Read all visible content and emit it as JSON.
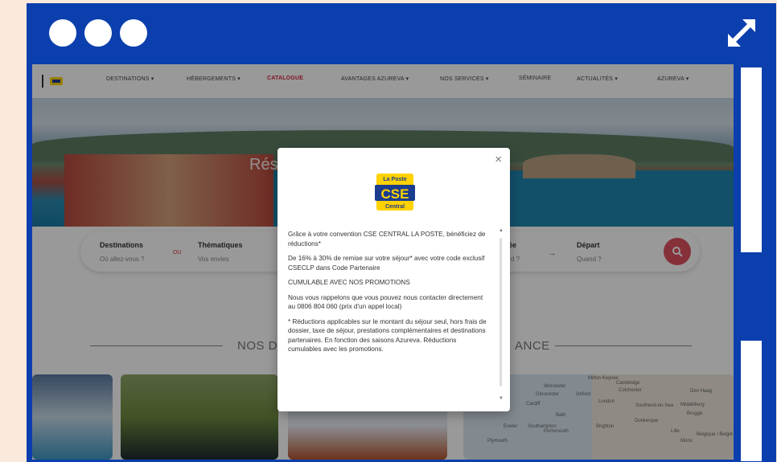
{
  "nav": {
    "items": [
      {
        "label": "DESTINATIONS ▾"
      },
      {
        "label": "HÉBERGEMENTS ▾"
      },
      {
        "label": "CATALOGUE"
      },
      {
        "label": "AVANTAGES AZUREVA ▾"
      },
      {
        "label": "NOS SERVICES ▾"
      },
      {
        "label": "SÉMINAIRE"
      },
      {
        "label": "ACTUALITÉS ▾"
      },
      {
        "label": "AZUREVA ▾"
      }
    ]
  },
  "hero": {
    "text": "Rés                                         es"
  },
  "search": {
    "destinations_label": "Destinations",
    "destinations_placeholder": "Où allez-vous ?",
    "ou": "OU",
    "thematiques_label": "Thématiques",
    "thematiques_placeholder": "Vos envies",
    "arrivee_label": "ée",
    "arrivee_placeholder": "d ?",
    "arrow": "→",
    "depart_label": "Départ",
    "depart_placeholder": "Quand ?"
  },
  "section": {
    "left": "NOS D",
    "right": "ANCE"
  },
  "map": {
    "labels": [
      "Milton Keynes",
      "Cambridge",
      "Worcester",
      "Colchester",
      "Gloucester",
      "Oxford",
      "London",
      "Den Haag",
      "Cardiff",
      "Southend-on-Sea",
      "Middelburg",
      "Bath",
      "Brugge",
      "Exeter",
      "Southampton",
      "Brighton",
      "Dunkerque",
      "Portsmouth",
      "Lille",
      "Plymouth",
      "Mons",
      "Belgique / België"
    ]
  },
  "modal": {
    "close": "×",
    "logo_top": "La Poste",
    "logo_main": "CSE",
    "logo_sub": "Central",
    "paragraphs": [
      "Grâce à votre convention CSE CENTRAL LA POSTE, bénéficiez de réductions*",
      "De 16% à 30% de remise sur votre séjour* avec votre code exclusif CSECLP dans Code Partenaire",
      "CUMULABLE AVEC NOS PROMOTIONS",
      "Nous vous rappelons que vous pouvez nous contacter directement au 0806 804 060 (prix d'un appel local)",
      "* Réductions applicables sur le montant du séjour seul, hors frais de dossier, taxe de séjour, prestations complémentaires et destinations partenaires. En fonction des saisons Azureva. Réductions cumulables avec les promotions."
    ]
  },
  "colors": {
    "frame": "#0b3fae",
    "accent": "#d7263d",
    "search_button": "#e0515f"
  }
}
